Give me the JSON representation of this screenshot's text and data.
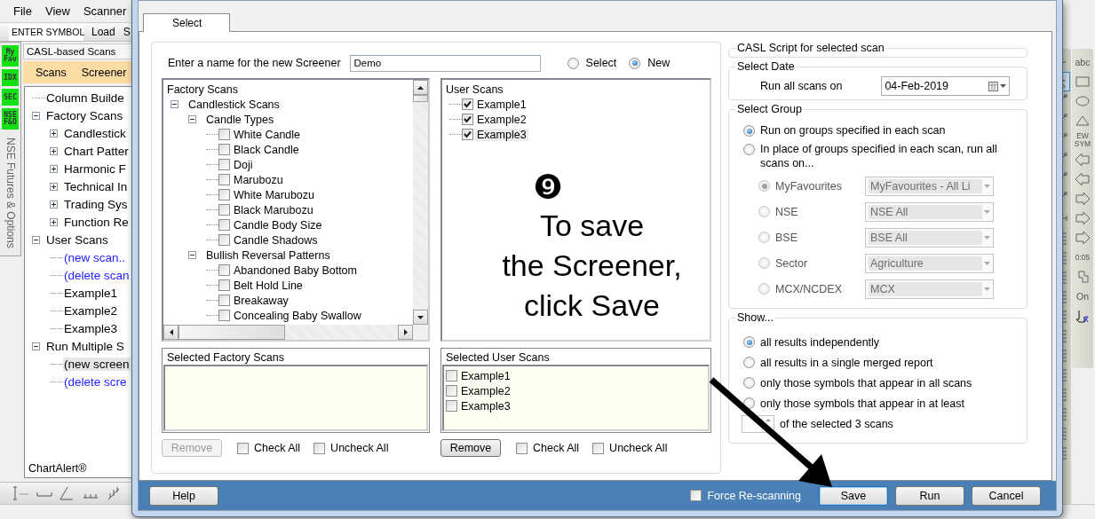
{
  "app": {
    "menu": [
      "File",
      "View",
      "Scanner"
    ],
    "toolbar": {
      "symbol_field": "ENTER SYMBOL",
      "buttons": [
        "Load",
        "S"
      ]
    },
    "side_tabs": [
      "My Fav",
      "IDX",
      "SEC",
      "NSE F&O"
    ],
    "side_label": "NSE Futures & Options",
    "panel_title": "CASL-based Scans",
    "panel_tabs": [
      "Scans",
      "Screener"
    ],
    "tree": [
      {
        "label": "Column Builde",
        "link": false,
        "selected": false
      },
      {
        "label": "Factory Scans",
        "link": false,
        "selected": false,
        "expanded": true,
        "children": [
          {
            "label": "Candlestick",
            "link": false,
            "selected": false,
            "expanded": false
          },
          {
            "label": "Chart Patter",
            "link": false,
            "selected": false,
            "expanded": false
          },
          {
            "label": "Harmonic F",
            "link": false,
            "selected": false,
            "expanded": false
          },
          {
            "label": "Technical In",
            "link": false,
            "selected": false,
            "expanded": false
          },
          {
            "label": "Trading Sys",
            "link": false,
            "selected": false,
            "expanded": false
          },
          {
            "label": "Function Re",
            "link": false,
            "selected": false,
            "expanded": false
          }
        ]
      },
      {
        "label": "User Scans",
        "link": false,
        "selected": false,
        "expanded": true,
        "children": [
          {
            "label": "(new scan..",
            "link": true,
            "selected": false
          },
          {
            "label": "(delete scan",
            "link": true,
            "selected": false
          },
          {
            "label": "Example1",
            "link": false,
            "selected": false
          },
          {
            "label": "Example2",
            "link": false,
            "selected": false
          },
          {
            "label": "Example3",
            "link": false,
            "selected": false
          }
        ]
      },
      {
        "label": "Run Multiple S",
        "link": false,
        "selected": false,
        "expanded": true,
        "children": [
          {
            "label": "(new screen",
            "link": false,
            "selected": true
          },
          {
            "label": "(delete scre",
            "link": true,
            "selected": false
          }
        ]
      }
    ],
    "brand": "ChartAlert®"
  },
  "drawing_tools": {
    "labels": [
      "abc",
      "EW SYM",
      "0:05",
      "On"
    ]
  },
  "dialog": {
    "tabs": [
      {
        "label": "Select",
        "selected": true
      }
    ],
    "name_label": "Enter a name for the new Screener",
    "name_value": "Demo",
    "mode_options": [
      {
        "label": "Select",
        "selected": false
      },
      {
        "label": "New",
        "selected": true
      }
    ],
    "factory_scans": {
      "title": "Factory Scans",
      "items": [
        {
          "label": "Candlestick Scans",
          "expanded": true,
          "children": [
            {
              "label": "Candle Types",
              "expanded": true,
              "children": [
                {
                  "label": "White Candle",
                  "checked": false
                },
                {
                  "label": "Black Candle",
                  "checked": false
                },
                {
                  "label": "Doji",
                  "checked": false
                },
                {
                  "label": "Marubozu",
                  "checked": false
                },
                {
                  "label": "White Marubozu",
                  "checked": false
                },
                {
                  "label": "Black Marubozu",
                  "checked": false
                },
                {
                  "label": "Candle Body Size",
                  "checked": false
                },
                {
                  "label": "Candle Shadows",
                  "checked": false
                }
              ]
            },
            {
              "label": "Bullish Reversal Patterns",
              "expanded": true,
              "children": [
                {
                  "label": "Abandoned Baby Bottom",
                  "checked": false
                },
                {
                  "label": "Belt Hold Line",
                  "checked": false
                },
                {
                  "label": "Breakaway",
                  "checked": false
                },
                {
                  "label": "Concealing Baby Swallow",
                  "checked": false
                }
              ]
            }
          ]
        }
      ]
    },
    "user_scans": {
      "title": "User Scans",
      "items": [
        {
          "label": "Example1",
          "checked": true,
          "selected": false
        },
        {
          "label": "Example2",
          "checked": true,
          "selected": false
        },
        {
          "label": "Example3",
          "checked": true,
          "selected": true
        }
      ]
    },
    "annotation": {
      "step": "❾",
      "lines": [
        "To save",
        "the Screener,",
        "click Save"
      ]
    },
    "selected_factory_scans": {
      "title": "Selected Factory Scans"
    },
    "selected_user_scans": {
      "title": "Selected User Scans",
      "items": [
        {
          "label": "Example1",
          "checked": false
        },
        {
          "label": "Example2",
          "checked": false
        },
        {
          "label": "Example3",
          "checked": false
        }
      ]
    },
    "factory_actions": {
      "remove": {
        "label": "Remove",
        "disabled": true
      },
      "check_all": {
        "label": "Check All",
        "checked": false
      },
      "uncheck_all": {
        "label": "Uncheck All",
        "checked": false
      }
    },
    "user_actions": {
      "remove": {
        "label": "Remove",
        "disabled": false
      },
      "check_all": {
        "label": "Check All",
        "checked": false
      },
      "uncheck_all": {
        "label": "Uncheck All",
        "checked": false
      }
    },
    "casl_script": {
      "title": "CASL Script for selected scan"
    },
    "select_date": {
      "title": "Select Date",
      "label": "Run all scans on",
      "value": "04-Feb-2019"
    },
    "select_group": {
      "title": "Select Group",
      "options": [
        {
          "label": "Run on groups specified in each scan",
          "selected": true
        },
        {
          "label": "In place of groups specified in each scan, run all scans on...",
          "selected": false
        }
      ],
      "sources": [
        {
          "label": "MyFavourites",
          "selected": true,
          "disabled": true,
          "value": "MyFavourites - All Li"
        },
        {
          "label": "NSE",
          "selected": false,
          "disabled": true,
          "value": "NSE All"
        },
        {
          "label": "BSE",
          "selected": false,
          "disabled": true,
          "value": "BSE All"
        },
        {
          "label": "Sector",
          "selected": false,
          "disabled": true,
          "value": "Agriculture"
        },
        {
          "label": "MCX/NCDEX",
          "selected": false,
          "disabled": true,
          "value": "MCX"
        }
      ]
    },
    "show": {
      "title": "Show...",
      "options": [
        {
          "label": "all results independently",
          "selected": true
        },
        {
          "label": "all results in a single merged report",
          "selected": false
        },
        {
          "label": "only those symbols that appear in all scans",
          "selected": false
        },
        {
          "label": "only those symbols that appear in at least",
          "selected": false
        }
      ],
      "spinner_suffix": "of the selected 3 scans"
    },
    "footer": {
      "help": "Help",
      "force_rescan": {
        "label": "Force Re-scanning",
        "checked": false
      },
      "buttons": [
        {
          "label": "Save",
          "kind": "default"
        },
        {
          "label": "Run",
          "kind": "normal"
        },
        {
          "label": "Cancel",
          "kind": "normal"
        }
      ]
    }
  }
}
